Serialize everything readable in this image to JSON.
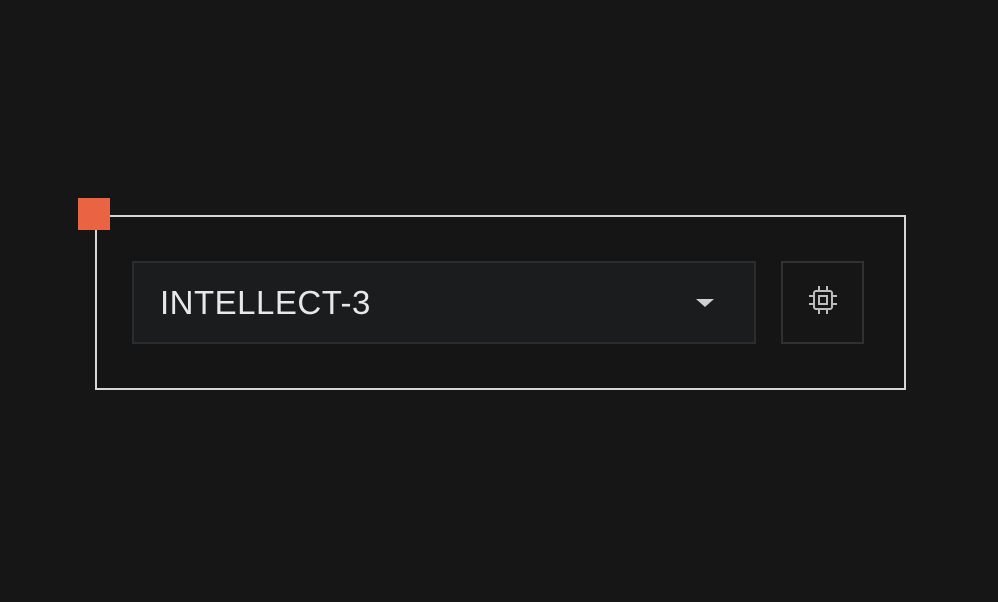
{
  "model_selector": {
    "selected_value": "INTELLECT-3",
    "dropdown_icon": "caret-down-icon"
  },
  "hardware_button": {
    "icon": "chip-icon"
  },
  "colors": {
    "background": "#161616",
    "frame_border": "#d6d6d6",
    "accent_marker": "#ea6444",
    "select_background": "#1b1c1e",
    "text": "#e8e8e8"
  }
}
